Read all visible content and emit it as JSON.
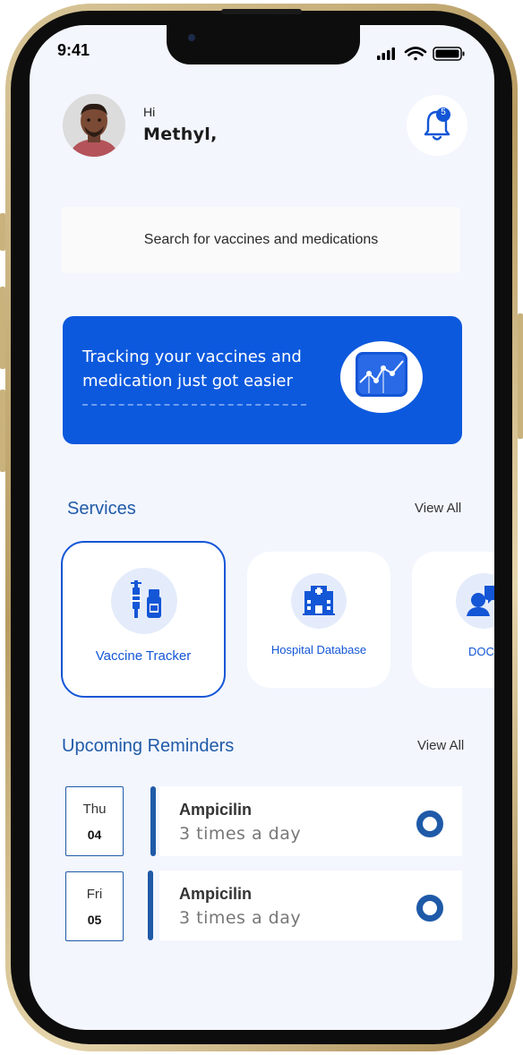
{
  "status_bar": {
    "time": "9:41"
  },
  "header": {
    "greeting": "Hi",
    "user_name": "Methyl,",
    "notification_count": "5"
  },
  "search": {
    "placeholder": "Search for vaccines and medications"
  },
  "banner": {
    "text": "Tracking your vaccines and medication just got easier",
    "icon": "line-chart-icon"
  },
  "services": {
    "title": "Services",
    "view_all": "View All",
    "items": [
      {
        "label": "Vaccine Tracker",
        "icon": "vaccine-icon",
        "active": true
      },
      {
        "label": "Hospital Database",
        "icon": "hospital-icon",
        "active": false
      },
      {
        "label": "DOC",
        "icon": "doctor-chat-icon",
        "active": false
      }
    ]
  },
  "reminders": {
    "title": "Upcoming Reminders",
    "view_all": "View All",
    "items": [
      {
        "day": "Thu",
        "date": "04",
        "name": "Ampicilin",
        "frequency": "3 times a day"
      },
      {
        "day": "Fri",
        "date": "05",
        "name": "Ampicilin",
        "frequency": "3 times a day"
      }
    ]
  },
  "colors": {
    "primary": "#0c59dd",
    "accent": "#1f5aa8",
    "background": "#f3f6fd"
  }
}
